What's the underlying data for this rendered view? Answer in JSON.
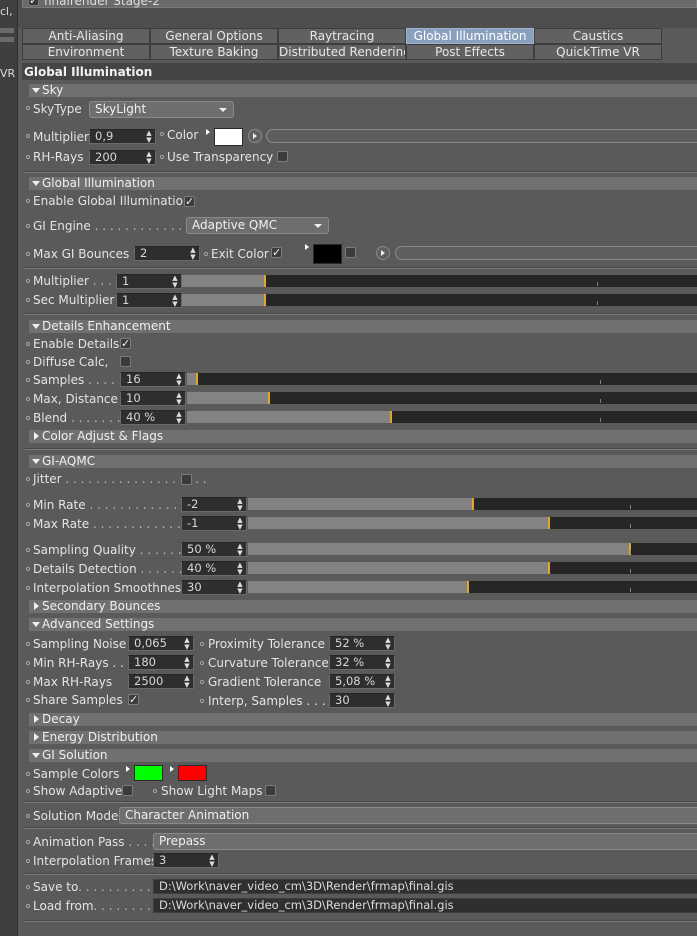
{
  "header": {
    "prev_label": "finalrender Stage-2",
    "left_a": "cl,",
    "left_b": "VR"
  },
  "tabs_row1": [
    "Anti-Aliasing",
    "General Options",
    "Raytracing",
    "Global Illumination",
    "Caustics"
  ],
  "tabs_row2": [
    "Environment",
    "Texture Baking",
    "Distributed Rendering",
    "Post Effects",
    "QuickTime VR"
  ],
  "page_title": "Global Illumination",
  "sky": {
    "section": "Sky",
    "skytype_label": "SkyType",
    "skytype_value": "SkyLight",
    "multiplier_label": "Multiplier",
    "multiplier_value": "0,9",
    "color_label": "Color",
    "color": "#ffffff",
    "rhrays_label": "RH-Rays",
    "rhrays_value": "200",
    "transparency_label": "Use Transparency"
  },
  "gi": {
    "section": "Global Illumination",
    "enable_label": "Enable Global Illumination",
    "engine_label": "GI Engine",
    "engine_dots": " . . . . . . . . . . . . . .",
    "engine_value": "Adaptive QMC",
    "bounces_label": "Max GI Bounces",
    "bounces_value": "2",
    "exit_label": "Exit Color",
    "exit_color": "#000000",
    "mult_label": "Multiplier",
    "mult_dots": " . . . .",
    "mult_value": "1",
    "sec_label": "Sec Multiplier",
    "sec_value": "1"
  },
  "details": {
    "section": "Details Enhancement",
    "enable_label": "Enable Details",
    "diffuse_label": "Diffuse Calc,",
    "samples_label": "Samples",
    "samples_dots": " . . . . .",
    "samples_value": "16",
    "samples_frac": 0.02,
    "dist_label": "Max, Distance",
    "dist_value": "10",
    "dist_frac": 0.16,
    "blend_label": "Blend",
    "blend_dots": " . . . . . . .",
    "blend_value": "40 %",
    "blend_frac": 0.4,
    "color_adjust": "Color Adjust & Flags"
  },
  "aqmc": {
    "section": "GI-AQMC",
    "jitter_label": "Jitter",
    "jitter_dots": " . . . . . . . . . . . . . . . . . . .",
    "minrate_label": "Min Rate",
    "minrate_dots": " . . . . . . . . . . . . .",
    "minrate_value": "-2",
    "minrate_frac": 0.5,
    "maxrate_label": "Max Rate",
    "maxrate_dots": " . . . . . . . . . . . . .",
    "maxrate_value": "-1",
    "maxrate_frac": 0.67,
    "quality_label": "Sampling Quality",
    "quality_dots": " . . . . . . .",
    "quality_value": "50 %",
    "quality_frac": 0.85,
    "detect_label": "Details Detection",
    "detect_dots": " . . . . . . . .",
    "detect_value": "40 %",
    "detect_frac": 0.67,
    "smooth_label": "Interpolation Smoothness",
    "smooth_value": "30",
    "smooth_frac": 0.49
  },
  "secondary": "Secondary Bounces",
  "advanced": {
    "section": "Advanced Settings",
    "noise_label": "Sampling Noise",
    "noise_value": "0,065",
    "minrh_label": "Min RH-Rays . .",
    "minrh_value": "180",
    "maxrh_label": "Max RH-Rays",
    "maxrh_value": "2500",
    "share_label": "Share Samples",
    "prox_label": "Proximity Tolerance",
    "prox_value": "52 %",
    "curv_label": "Curvature Tolerance",
    "curv_value": "32 %",
    "grad_label": "Gradient Tolerance",
    "grad_value": "5,08 %",
    "interp_label": "Interp, Samples . . . .",
    "interp_value": "30"
  },
  "decay": "Decay",
  "energy": "Energy Distribution",
  "solution": {
    "section": "GI Solution",
    "sample_colors_label": "Sample Colors",
    "color_a": "#00ff00",
    "color_b": "#ff0000",
    "show_adaptive": "Show Adaptive",
    "show_lightmaps": "Show Light Maps"
  },
  "mode": {
    "label": "Solution Mode",
    "value": "Character Animation",
    "pass_label": "Animation Pass",
    "pass_dots": " . . . .",
    "pass_value": "Prepass",
    "frames_label": "Interpolation Frames",
    "frames_value": "3"
  },
  "files": {
    "save_label": "Save to",
    "save_dots": ". . . . . . . . . . . . .",
    "save_path": "D:\\Work\\naver_video_cm\\3D\\Render\\frmap\\final.gis",
    "load_label": "Load from",
    "load_dots": ". . . . . . . . . . .",
    "load_path": "D:\\Work\\naver_video_cm\\3D\\Render\\frmap\\final.gis"
  }
}
